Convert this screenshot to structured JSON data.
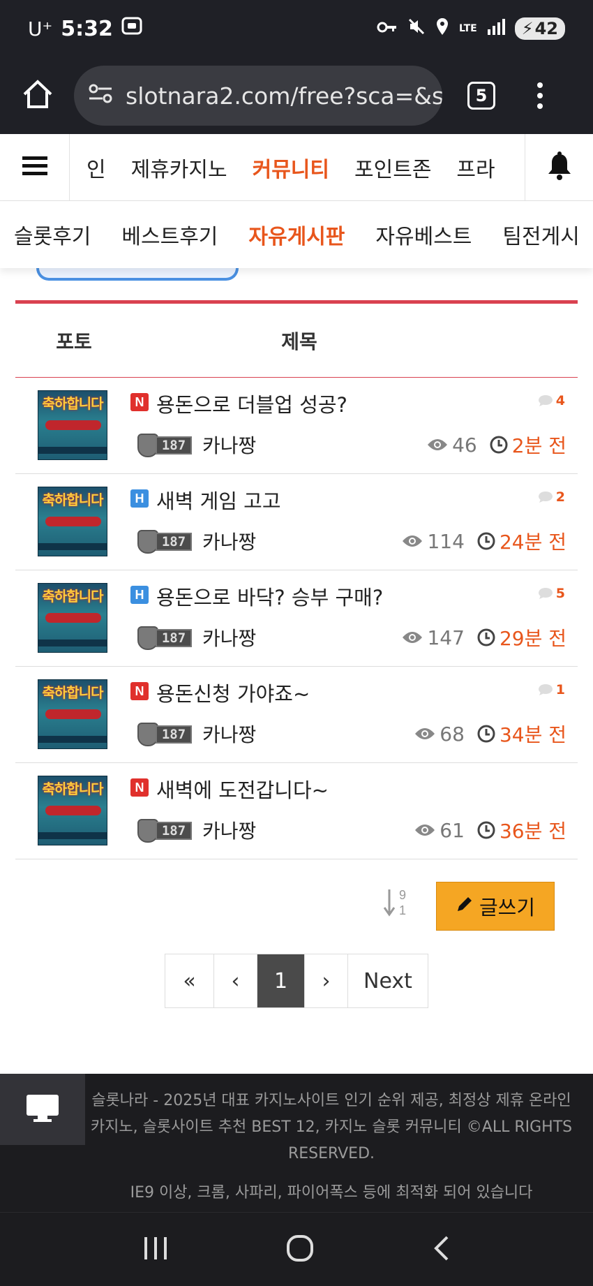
{
  "status": {
    "carrier": "U⁺",
    "time": "5:32",
    "battery": "42",
    "network": "LTE"
  },
  "browser": {
    "url": "slotnara2.com/free?sca=&st",
    "tab_count": "5"
  },
  "nav": {
    "items": [
      "인",
      "제휴카지노",
      "커뮤니티",
      "포인트존",
      "프라"
    ],
    "active": "커뮤니티"
  },
  "subnav": {
    "items": [
      "슬롯후기",
      "베스트후기",
      "자유게시판",
      "자유베스트",
      "팀전게시"
    ],
    "active": "자유게시판"
  },
  "list": {
    "col_photo": "포토",
    "col_title": "제목",
    "thumb_text": "축하합니다",
    "posts": [
      {
        "badge": "N",
        "title": "용돈으로 더블업 성공?",
        "comments": "4",
        "level": "187",
        "author": "카나짱",
        "views": "46",
        "time": "2분 전"
      },
      {
        "badge": "H",
        "title": "새벽 게임 고고",
        "comments": "2",
        "level": "187",
        "author": "카나짱",
        "views": "114",
        "time": "24분 전"
      },
      {
        "badge": "H",
        "title": "용돈으로 바닥? 승부 구매?",
        "comments": "5",
        "level": "187",
        "author": "카나짱",
        "views": "147",
        "time": "29분 전"
      },
      {
        "badge": "N",
        "title": "용돈신청 가야죠~",
        "comments": "1",
        "level": "187",
        "author": "카나짱",
        "views": "68",
        "time": "34분 전"
      },
      {
        "badge": "N",
        "title": "새벽에 도전갑니다~",
        "comments": "",
        "level": "187",
        "author": "카나짱",
        "views": "61",
        "time": "36분 전"
      }
    ]
  },
  "actions": {
    "write_label": "글쓰기",
    "sort_top": "9",
    "sort_bottom": "1"
  },
  "pager": {
    "first": "«",
    "prev": "‹",
    "current": "1",
    "next": "›",
    "next_label": "Next"
  },
  "footer": {
    "line1": "슬롯나라 - 2025년 대표 카지노사이트 인기 순위 제공, 최정상 제휴 온라인 카지노, 슬롯사이트 추천 BEST 12, 카지노 슬롯 커뮤니티 ©ALL RIGHTS RESERVED.",
    "line2": "IE9 이상, 크롬, 사파리, 파이어폭스 등에 최적화 되어 있습니다"
  },
  "colors": {
    "accent": "#e8561c",
    "red_line": "#d94150",
    "write_button": "#f5a623",
    "badge_new": "#e0302c",
    "badge_hot": "#3b8fe0"
  }
}
